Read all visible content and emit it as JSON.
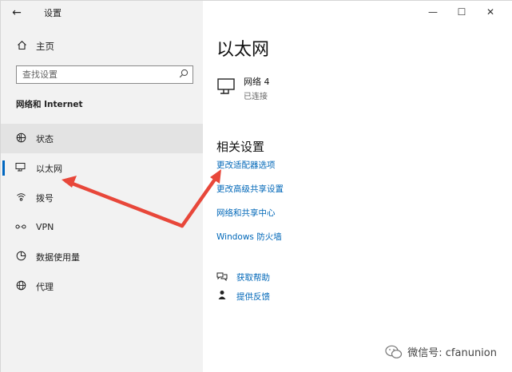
{
  "titlebar": {
    "back_icon": "arrow-left-icon",
    "title": "设置",
    "min": "—",
    "max": "☐",
    "close": "✕"
  },
  "sidebar": {
    "home_label": "主页",
    "search_placeholder": "查找设置",
    "section_title": "网络和 Internet",
    "items": [
      {
        "label": "状态",
        "icon": "globe-status-icon"
      },
      {
        "label": "以太网",
        "icon": "ethernet-icon"
      },
      {
        "label": "拨号",
        "icon": "dialup-icon"
      },
      {
        "label": "VPN",
        "icon": "vpn-icon"
      },
      {
        "label": "数据使用量",
        "icon": "data-usage-icon"
      },
      {
        "label": "代理",
        "icon": "globe-proxy-icon"
      }
    ]
  },
  "main": {
    "title": "以太网",
    "network": {
      "name": "网络 4",
      "state": "已连接"
    },
    "related_title": "相关设置",
    "links": [
      "更改适配器选项",
      "更改高级共享设置",
      "网络和共享中心",
      "Windows 防火墙"
    ],
    "help": [
      {
        "label": "获取帮助",
        "icon": "help-chat-icon"
      },
      {
        "label": "提供反馈",
        "icon": "feedback-icon"
      }
    ]
  },
  "watermark": {
    "text": "微信号: cfanunion"
  },
  "colors": {
    "accent": "#0067c0",
    "link": "#0067b8",
    "arrow": "#e8473a",
    "sidebar_bg": "#f2f2f2"
  }
}
